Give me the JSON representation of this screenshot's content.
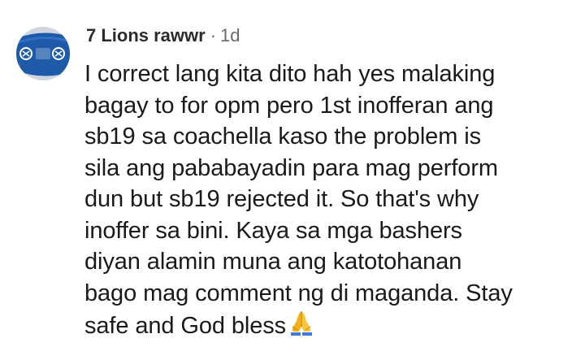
{
  "comment": {
    "author": "7 Lions rawwr",
    "separator": "·",
    "timestamp": "1d",
    "avatar_icon": "team-logo-avatar",
    "lines": [
      "I correct lang kita dito hah yes malaking",
      "bagay to for opm pero 1st inofferan ang",
      "sb19 sa coachella kaso the problem is",
      "sila ang pababayadin para mag perform",
      "dun but sb19 rejected it. So that's why",
      "inoffer sa bini. Kaya sa mga bashers",
      "diyan alamin muna ang katotohanan",
      "bago mag comment ng di maganda. Stay",
      "safe and God bless"
    ],
    "trailing_emoji": "folded-hands-icon"
  },
  "colors": {
    "text": "#1a1a1a",
    "meta": "#6b6b6b",
    "avatar_blue": "#1f5aa8",
    "emoji_gold": "#f2b01e"
  }
}
